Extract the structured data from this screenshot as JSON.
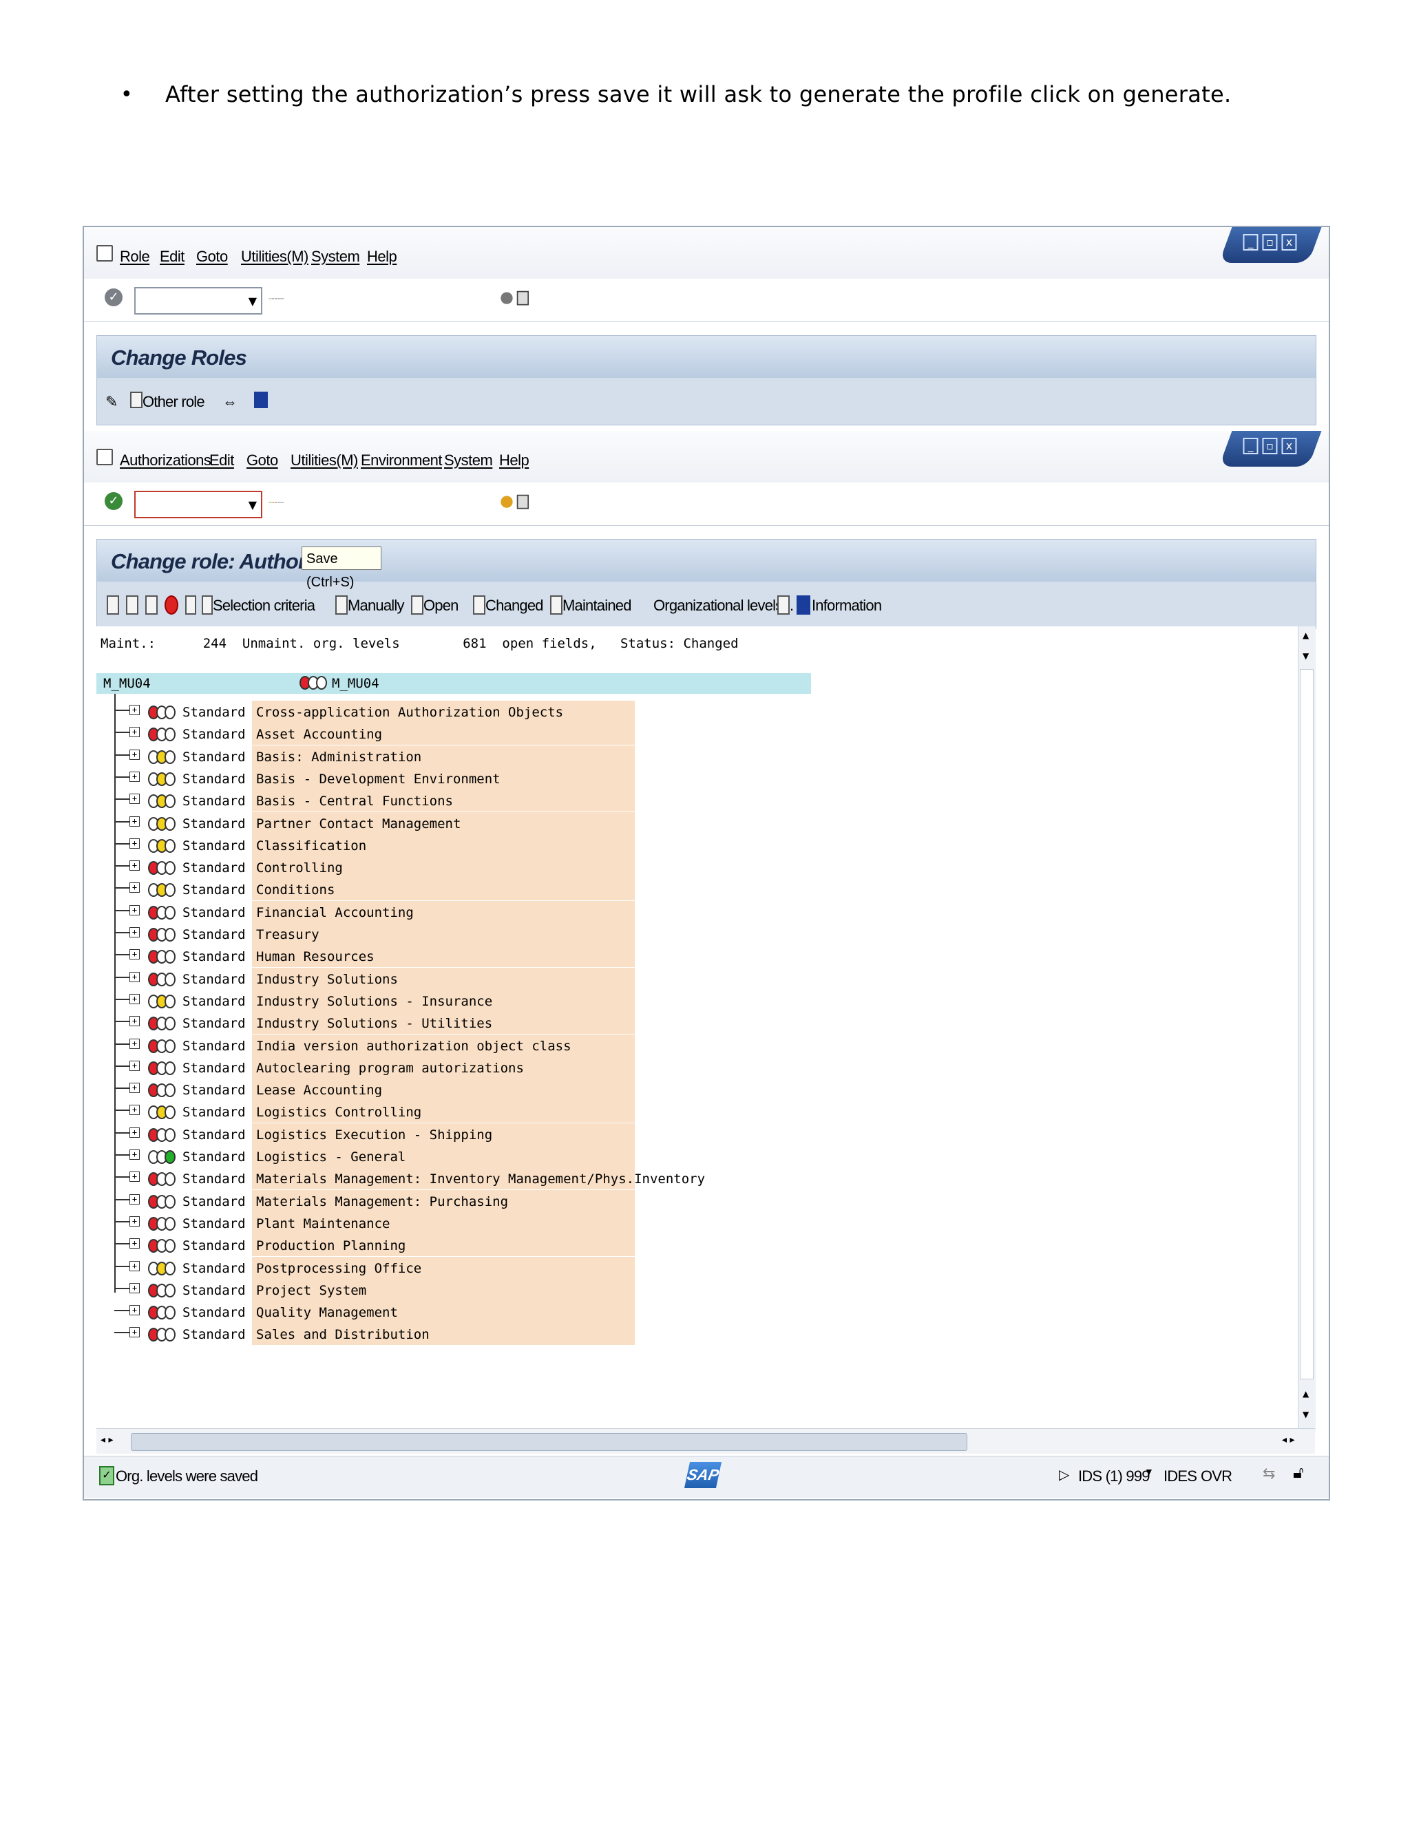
{
  "document": {
    "bullet": "•",
    "text": "After setting the authorization’s press save it will ask to generate the profile click on generate."
  },
  "window1": {
    "menu": [
      "Role",
      "Edit",
      "Goto",
      "Utilities(M)",
      "System",
      "Help"
    ],
    "title": "Change Roles",
    "other_role_label": "Other role"
  },
  "window2": {
    "menu": [
      "Authorizations",
      "Edit",
      "Goto",
      "Utilities(M)",
      "Environment",
      "System",
      "Help"
    ],
    "title": "Change role: Authorizati",
    "tooltip": "Save   (Ctrl+S)",
    "app_buttons": [
      "Selection criteria",
      "Manually",
      "Open",
      "Changed",
      "Maintained",
      "Organizational levels...",
      "Information"
    ],
    "header_line": "Maint.:      244  Unmaint. org. levels        681  open fields,   Status: Changed",
    "root_left": "M_MU04",
    "root_right": "M_MU04",
    "rows": [
      {
        "lights": [
          "red",
          "off",
          "off"
        ],
        "type": "Standard",
        "desc": "Cross-application Authorization Objects"
      },
      {
        "lights": [
          "red",
          "off",
          "off"
        ],
        "type": "Standard",
        "desc": "Asset Accounting"
      },
      {
        "lights": [
          "off",
          "yellow",
          "off"
        ],
        "type": "Standard",
        "desc": "Basis: Administration"
      },
      {
        "lights": [
          "off",
          "yellow",
          "off"
        ],
        "type": "Standard",
        "desc": "Basis - Development Environment"
      },
      {
        "lights": [
          "off",
          "yellow",
          "off"
        ],
        "type": "Standard",
        "desc": "Basis - Central Functions"
      },
      {
        "lights": [
          "off",
          "yellow",
          "off"
        ],
        "type": "Standard",
        "desc": "Partner Contact Management"
      },
      {
        "lights": [
          "off",
          "yellow",
          "off"
        ],
        "type": "Standard",
        "desc": "Classification"
      },
      {
        "lights": [
          "red",
          "off",
          "off"
        ],
        "type": "Standard",
        "desc": "Controlling"
      },
      {
        "lights": [
          "off",
          "yellow",
          "off"
        ],
        "type": "Standard",
        "desc": "Conditions"
      },
      {
        "lights": [
          "red",
          "off",
          "off"
        ],
        "type": "Standard",
        "desc": "Financial Accounting"
      },
      {
        "lights": [
          "red",
          "off",
          "off"
        ],
        "type": "Standard",
        "desc": "Treasury"
      },
      {
        "lights": [
          "red",
          "off",
          "off"
        ],
        "type": "Standard",
        "desc": "Human Resources"
      },
      {
        "lights": [
          "red",
          "off",
          "off"
        ],
        "type": "Standard",
        "desc": "Industry Solutions"
      },
      {
        "lights": [
          "off",
          "yellow",
          "off"
        ],
        "type": "Standard",
        "desc": "Industry Solutions - Insurance"
      },
      {
        "lights": [
          "red",
          "off",
          "off"
        ],
        "type": "Standard",
        "desc": "Industry Solutions - Utilities"
      },
      {
        "lights": [
          "red",
          "off",
          "off"
        ],
        "type": "Standard",
        "desc": "India version authorization object class"
      },
      {
        "lights": [
          "red",
          "off",
          "off"
        ],
        "type": "Standard",
        "desc": "Autoclearing program autorizations"
      },
      {
        "lights": [
          "red",
          "off",
          "off"
        ],
        "type": "Standard",
        "desc": "Lease Accounting"
      },
      {
        "lights": [
          "off",
          "yellow",
          "off"
        ],
        "type": "Standard",
        "desc": "Logistics Controlling"
      },
      {
        "lights": [
          "red",
          "off",
          "off"
        ],
        "type": "Standard",
        "desc": "Logistics Execution - Shipping"
      },
      {
        "lights": [
          "off",
          "off",
          "green"
        ],
        "type": "Standard",
        "desc": "Logistics - General"
      },
      {
        "lights": [
          "red",
          "off",
          "off"
        ],
        "type": "Standard",
        "desc": "Materials Management: Inventory Management/Phys.Inventory"
      },
      {
        "lights": [
          "red",
          "off",
          "off"
        ],
        "type": "Standard",
        "desc": "Materials Management: Purchasing"
      },
      {
        "lights": [
          "red",
          "off",
          "off"
        ],
        "type": "Standard",
        "desc": "Plant Maintenance"
      },
      {
        "lights": [
          "red",
          "off",
          "off"
        ],
        "type": "Standard",
        "desc": "Production Planning"
      },
      {
        "lights": [
          "off",
          "yellow",
          "off"
        ],
        "type": "Standard",
        "desc": "Postprocessing Office"
      },
      {
        "lights": [
          "red",
          "off",
          "off"
        ],
        "type": "Standard",
        "desc": "Project System"
      },
      {
        "lights": [
          "red",
          "off",
          "off"
        ],
        "type": "Standard",
        "desc": "Quality Management"
      },
      {
        "lights": [
          "red",
          "off",
          "off"
        ],
        "type": "Standard",
        "desc": "Sales and Distribution"
      }
    ],
    "status": {
      "message": "Org. levels were saved",
      "logo": "SAP",
      "system": "IDS (1) 999",
      "server": "IDES",
      "mode": "OVR"
    }
  },
  "colors": {
    "red": "#e0202a",
    "yellow": "#f2d21b",
    "green": "#22b02a",
    "off": "#ffffff"
  }
}
